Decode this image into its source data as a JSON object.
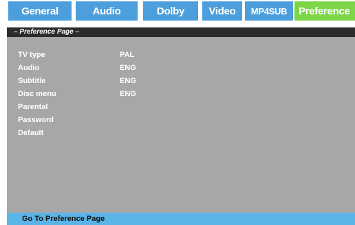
{
  "tabs": [
    {
      "label": "General"
    },
    {
      "label": "Audio"
    },
    {
      "label": "Dolby"
    },
    {
      "label": "Video"
    },
    {
      "label": "MP4SUB"
    },
    {
      "label": "Preference"
    }
  ],
  "colors": {
    "tab_bg": "#4c9fdc",
    "tab_active_bg": "#7cd648",
    "panel_bg": "#a7a7a7",
    "header_bg": "#2c2c2c",
    "status_bg": "#5bb4e6"
  },
  "page": {
    "header": "– Preference Page –",
    "items": [
      {
        "label": "TV type",
        "value": "PAL"
      },
      {
        "label": "Audio",
        "value": "ENG"
      },
      {
        "label": "Subtitle",
        "value": "ENG"
      },
      {
        "label": "Disc menu",
        "value": "ENG"
      },
      {
        "label": "Parental",
        "value": ""
      },
      {
        "label": "Password",
        "value": ""
      },
      {
        "label": "Default",
        "value": ""
      }
    ]
  },
  "status": "Go To Preference Page"
}
